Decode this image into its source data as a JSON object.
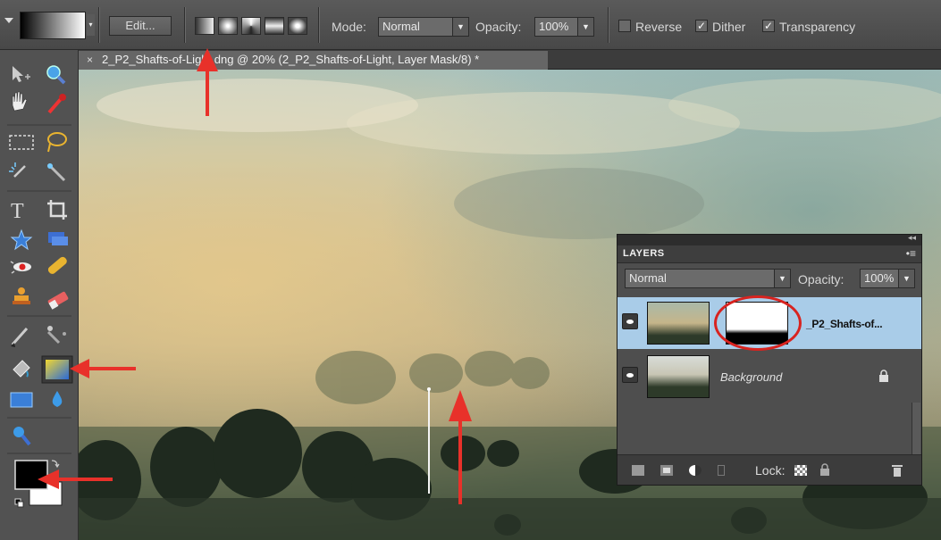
{
  "options_bar": {
    "edit_label": "Edit...",
    "mode_label": "Mode:",
    "mode_value": "Normal",
    "opacity_label": "Opacity:",
    "opacity_value": "100%",
    "reverse_label": "Reverse",
    "reverse_checked": false,
    "dither_label": "Dither",
    "dither_checked": true,
    "transparency_label": "Transparency",
    "transparency_checked": true,
    "gradient_types": [
      "linear-gradient-icon",
      "radial-gradient-icon",
      "angle-gradient-icon",
      "reflected-gradient-icon",
      "diamond-gradient-icon"
    ]
  },
  "document_tab": {
    "close_glyph": "×",
    "title": "2_P2_Shafts-of-Light.dng @ 20% (2_P2_Shafts-of-Light, Layer Mask/8) *"
  },
  "toolbox": {
    "tools": [
      "move-tool-icon",
      "zoom-tool-icon",
      "hand-tool-icon",
      "eyedropper-tool-icon",
      "marquee-tool-icon",
      "lasso-tool-icon",
      "magic-wand-tool-icon",
      "quick-selection-tool-icon",
      "type-tool-icon",
      "crop-tool-icon",
      "cookie-cutter-tool-icon",
      "straighten-tool-icon",
      "red-eye-tool-icon",
      "healing-brush-tool-icon",
      "clone-stamp-tool-icon",
      "eraser-tool-icon",
      "brush-tool-icon",
      "smart-brush-tool-icon",
      "paint-bucket-tool-icon",
      "gradient-tool-icon",
      "shape-tool-icon",
      "blur-tool-icon",
      "sponge-tool-icon"
    ],
    "foreground_color": "#000000",
    "background_color": "#ffffff"
  },
  "layers_panel": {
    "title": "LAYERS",
    "menu_glyph": "•≡",
    "blend_mode": "Normal",
    "opacity_label": "Opacity:",
    "opacity_value": "100%",
    "layers": [
      {
        "name": "_P2_Shafts-of...",
        "selected": true,
        "has_mask": true
      },
      {
        "name": "Background",
        "selected": false,
        "locked": true
      }
    ],
    "lock_label": "Lock:"
  },
  "annotations": {
    "arrow_color": "#e8312a",
    "highlight_color": "#d8231f"
  }
}
